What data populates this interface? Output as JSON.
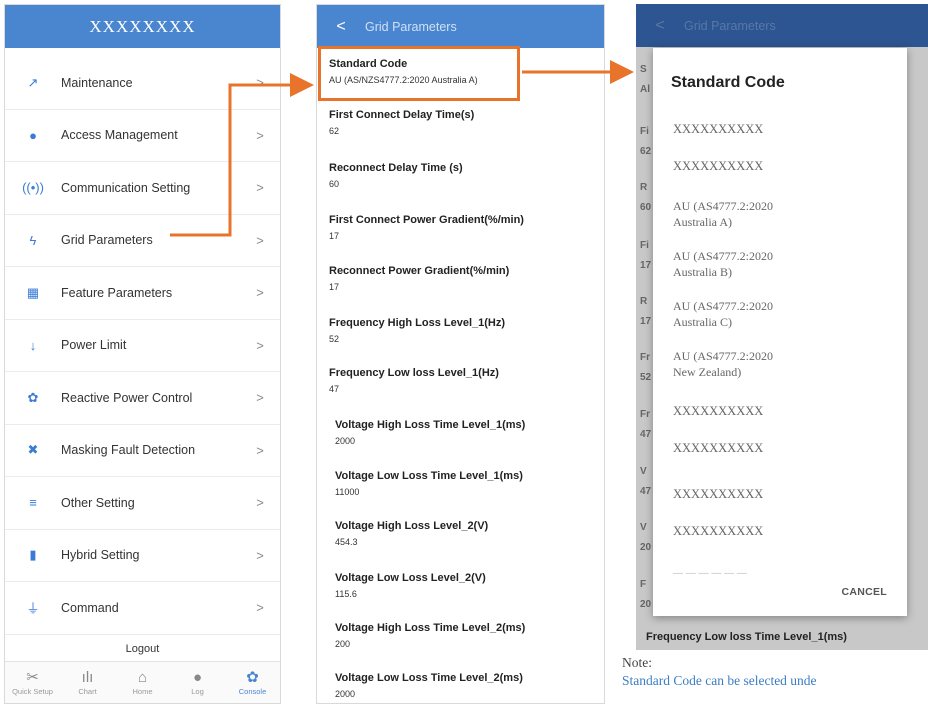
{
  "menu_panel": {
    "title": "XXXXXXXX",
    "items": [
      {
        "label": "Maintenance",
        "icon": "wrench-icon",
        "glyph": "↗"
      },
      {
        "label": "Access Management",
        "icon": "user-icon",
        "glyph": "●"
      },
      {
        "label": "Communication Setting",
        "icon": "signal-icon",
        "glyph": "((•))"
      },
      {
        "label": "Grid Parameters",
        "icon": "lightning-icon",
        "glyph": "ϟ"
      },
      {
        "label": "Feature Parameters",
        "icon": "grid-table-icon",
        "glyph": "▦"
      },
      {
        "label": "Power Limit",
        "icon": "arrow-down-icon",
        "glyph": "↓"
      },
      {
        "label": "Reactive Power Control",
        "icon": "gear-icon",
        "glyph": "✿"
      },
      {
        "label": "Masking Fault Detection",
        "icon": "muted-bell-icon",
        "glyph": "✖"
      },
      {
        "label": "Other Setting",
        "icon": "menu-lines-icon",
        "glyph": "≡"
      },
      {
        "label": "Hybrid Setting",
        "icon": "battery-icon",
        "glyph": "▮"
      },
      {
        "label": "Command",
        "icon": "ground-icon",
        "glyph": "⏚"
      }
    ],
    "chevron": ">",
    "logout": "Logout",
    "tabs": [
      {
        "label": "Quick Setup",
        "icon": "tools-icon",
        "glyph": "✂"
      },
      {
        "label": "Chart",
        "icon": "chart-icon",
        "glyph": "ılı"
      },
      {
        "label": "Home",
        "icon": "home-icon",
        "glyph": "⌂"
      },
      {
        "label": "Log",
        "icon": "info-icon",
        "glyph": "●"
      },
      {
        "label": "Console",
        "icon": "gear-icon",
        "glyph": "✿"
      }
    ]
  },
  "grid_panel": {
    "back": "<",
    "title": "Grid Parameters",
    "params": [
      {
        "label": "Standard Code",
        "value": "AU (AS/NZS4777.2:2020 Australia A)"
      },
      {
        "label": "First Connect Delay Time(s)",
        "value": "62"
      },
      {
        "label": "Reconnect Delay Time (s)",
        "value": "60"
      },
      {
        "label": "First Connect Power Gradient(%/min)",
        "value": "17"
      },
      {
        "label": "Reconnect Power Gradient(%/min)",
        "value": "17"
      },
      {
        "label": "Frequency High Loss Level_1(Hz)",
        "value": "52"
      },
      {
        "label": "Frequency Low loss Level_1(Hz)",
        "value": "47"
      },
      {
        "label": "Voltage High Loss Time Level_1(ms)",
        "value": "2000"
      },
      {
        "label": "Voltage Low Loss Time Level_1(ms)",
        "value": "11000"
      },
      {
        "label": "Voltage High Loss Level_2(V)",
        "value": "454.3"
      },
      {
        "label": "Voltage Low Loss Level_2(V)",
        "value": "115.6"
      },
      {
        "label": "Voltage High Loss Time Level_2(ms)",
        "value": "200"
      },
      {
        "label": "Voltage Low Loss Time Level_2(ms)",
        "value": "2000"
      }
    ]
  },
  "dialog_panel": {
    "back": "<",
    "title": "Grid Parameters",
    "bg_fragments": [
      "S",
      "Al",
      "Fi",
      "62",
      "R",
      "60",
      "Fi",
      "17",
      "R",
      "17",
      "Fr",
      "52",
      "Fr",
      "47",
      "V",
      "47",
      "V",
      "20",
      "F",
      "20"
    ],
    "bottom_label": "Frequency Low loss Time Level_1(ms)",
    "dialog": {
      "title": "Standard Code",
      "options": [
        "XXXXXXXXXX",
        "XXXXXXXXXX",
        "AU (AS4777.2:2020\nAustralia A)",
        "AU (AS4777.2:2020\nAustralia B)",
        "AU (AS4777.2:2020\nAustralia C)",
        "AU (AS4777.2:2020\nNew Zealand)",
        "XXXXXXXXXX",
        "XXXXXXXXXX",
        "XXXXXXXXXX",
        "XXXXXXXXXX"
      ],
      "cancel": "CANCEL"
    }
  },
  "note": {
    "heading": "Note:",
    "text": "Standard Code can be selected unde"
  },
  "colors": {
    "header_blue": "#4a86cf",
    "header_dim": "#2c5591",
    "annotation_orange": "#e8732b",
    "icon_blue": "#3a7bd5"
  }
}
